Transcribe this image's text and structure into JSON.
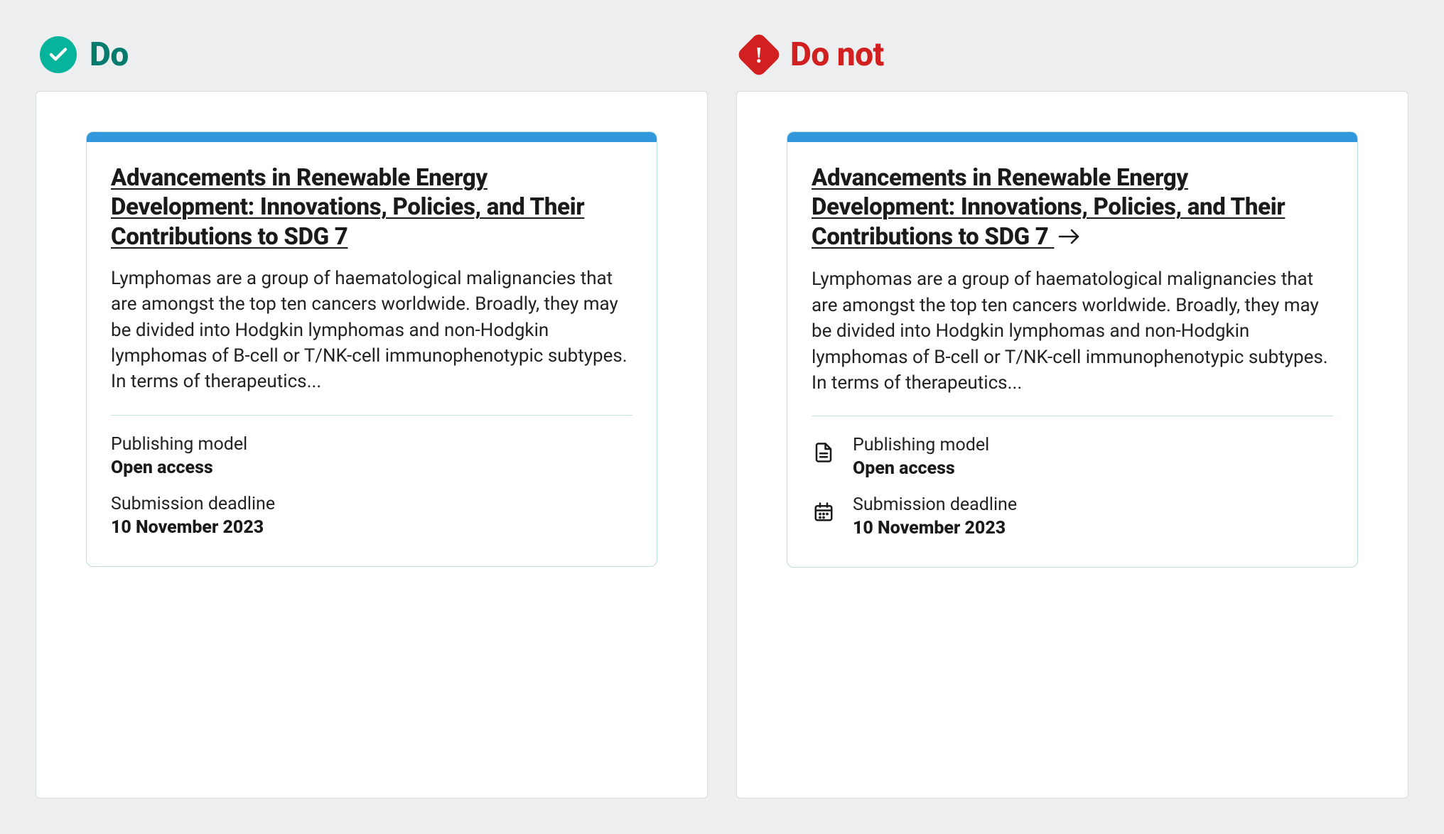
{
  "do": {
    "header": "Do",
    "card": {
      "title": "Advancements in Renewable Energy Development: Innovations, Policies, and Their Contributions to SDG 7",
      "description": "Lymphomas are a group of haematological malignancies that are amongst the top ten cancers worldwide. Broadly, they may be divided into Hodgkin lymphomas and non-Hodgkin lymphomas of B-cell or T/NK-cell immunophenotypic subtypes. In terms of therapeutics...",
      "meta": {
        "publishing_label": "Publishing model",
        "publishing_value": "Open access",
        "deadline_label": "Submission deadline",
        "deadline_value": "10 November 2023"
      }
    }
  },
  "donot": {
    "header": "Do not",
    "card": {
      "title": "Advancements in Renewable Energy Development: Innovations, Policies, and Their Contributions to SDG 7",
      "description": "Lymphomas are a group of haematological malignancies that are amongst the top ten cancers worldwide. Broadly, they may be divided into Hodgkin lymphomas and non-Hodgkin lymphomas of B-cell or T/NK-cell immunophenotypic subtypes. In terms of therapeutics...",
      "meta": {
        "publishing_label": "Publishing model",
        "publishing_value": "Open access",
        "deadline_label": "Submission deadline",
        "deadline_value": "10 November 2023"
      }
    }
  }
}
